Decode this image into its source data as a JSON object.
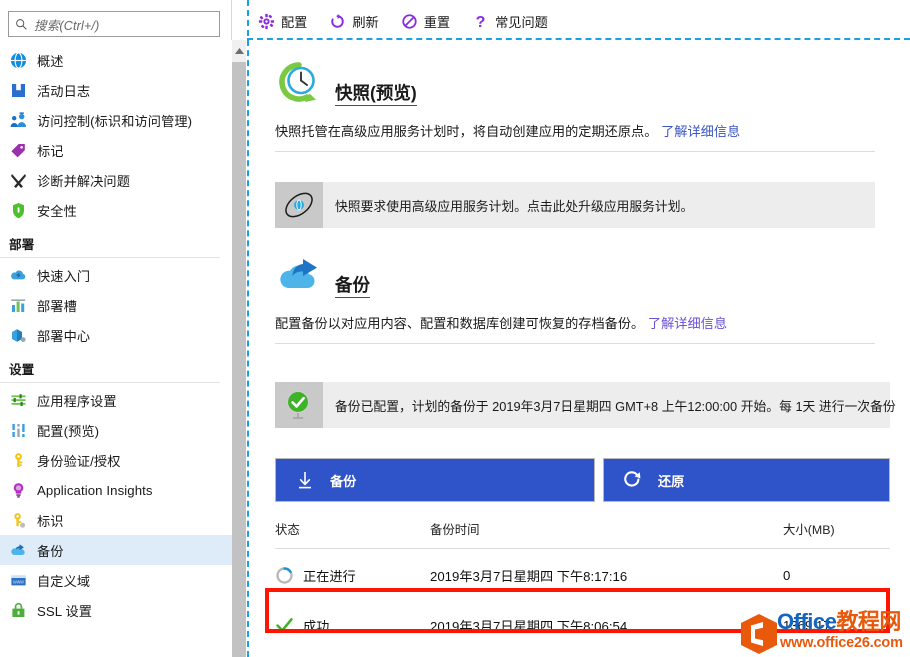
{
  "sidebar": {
    "search": {
      "placeholder": "搜索(Ctrl+/)",
      "icon": "search-icon"
    },
    "collapse_label": "«",
    "items": [
      {
        "label": "概述",
        "icon": "overview-globe-icon",
        "selected": false
      },
      {
        "label": "活动日志",
        "icon": "activity-log-book-icon",
        "selected": false
      },
      {
        "label": "访问控制(标识和访问管理)",
        "icon": "access-control-people-icon",
        "selected": false
      },
      {
        "label": "标记",
        "icon": "tag-icon",
        "selected": false
      },
      {
        "label": "诊断并解决问题",
        "icon": "diagnose-tools-icon",
        "selected": false
      },
      {
        "label": "安全性",
        "icon": "security-shield-icon",
        "selected": false
      }
    ],
    "groups": [
      {
        "title": "部署",
        "items": [
          {
            "label": "快速入门",
            "icon": "quickstart-cloud-icon",
            "selected": false
          },
          {
            "label": "部署槽",
            "icon": "deployment-slots-bars-icon",
            "selected": false
          },
          {
            "label": "部署中心",
            "icon": "deployment-center-box-icon",
            "selected": false
          }
        ]
      },
      {
        "title": "设置",
        "items": [
          {
            "label": "应用程序设置",
            "icon": "app-settings-sliders-icon",
            "selected": false
          },
          {
            "label": "配置(预览)",
            "icon": "configuration-sliders-icon",
            "selected": false
          },
          {
            "label": "身份验证/授权",
            "icon": "auth-key-icon",
            "selected": false
          },
          {
            "label": "Application Insights",
            "icon": "app-insights-bulb-icon",
            "selected": false
          },
          {
            "label": "标识",
            "icon": "identity-key-icon",
            "selected": false
          },
          {
            "label": "备份",
            "icon": "backup-cloud-icon",
            "selected": true
          },
          {
            "label": "自定义域",
            "icon": "custom-domain-www-icon",
            "selected": false
          },
          {
            "label": "SSL 设置",
            "icon": "ssl-settings-lock-icon",
            "selected": false
          }
        ]
      }
    ]
  },
  "toolbar": {
    "items": [
      {
        "label": "配置",
        "icon": "gear-icon"
      },
      {
        "label": "刷新",
        "icon": "refresh-icon"
      },
      {
        "label": "重置",
        "icon": "reset-ban-icon"
      },
      {
        "label": "常见问题",
        "icon": "question-mark-icon"
      }
    ]
  },
  "snapshot": {
    "title": "快照(预览)",
    "icon": "clock-refresh-icon",
    "description": "快照托管在高级应用服务计划时，将自动创建应用的定期还原点。",
    "link": "了解详细信息",
    "banner": {
      "icon": "not-available-icon",
      "text": "快照要求使用高级应用服务计划。点击此处升级应用服务计划。"
    }
  },
  "backup": {
    "title": "备份",
    "icon": "cloud-upload-icon",
    "description": "配置备份以对应用内容、配置和数据库创建可恢复的存档备份。",
    "link": "了解详细信息",
    "banner": {
      "icon": "success-check-icon",
      "text": "备份已配置，计划的备份于 2019年3月7日星期四 GMT+8 上午12:00:00 开始。每 1天 进行一次备份"
    },
    "actions": [
      {
        "label": "备份",
        "icon": "download-arrow-icon"
      },
      {
        "label": "还原",
        "icon": "restore-arrow-icon"
      }
    ],
    "table": {
      "columns": [
        "状态",
        "备份时间",
        "大小(MB)"
      ],
      "rows": [
        {
          "status": "正在进行",
          "status_icon": "in-progress-spinner-icon",
          "time": "2019年3月7日星期四 下午8:17:16",
          "size": "0"
        },
        {
          "status": "成功",
          "status_icon": "success-checkmark-icon",
          "time": "2019年3月7日星期四 下午8:06:54",
          "size": "1369.17"
        }
      ]
    }
  },
  "annotation": {
    "color": "#ff1500"
  },
  "watermark": {
    "brand_blue": "Office",
    "brand_orange": "教程网",
    "url": "www.office26.com"
  },
  "colors": {
    "accent_blue": "#2f53c8",
    "link_blue": "#3b55c4",
    "selected_bg": "#deecf9",
    "dashed_border": "#1ca0e8"
  }
}
